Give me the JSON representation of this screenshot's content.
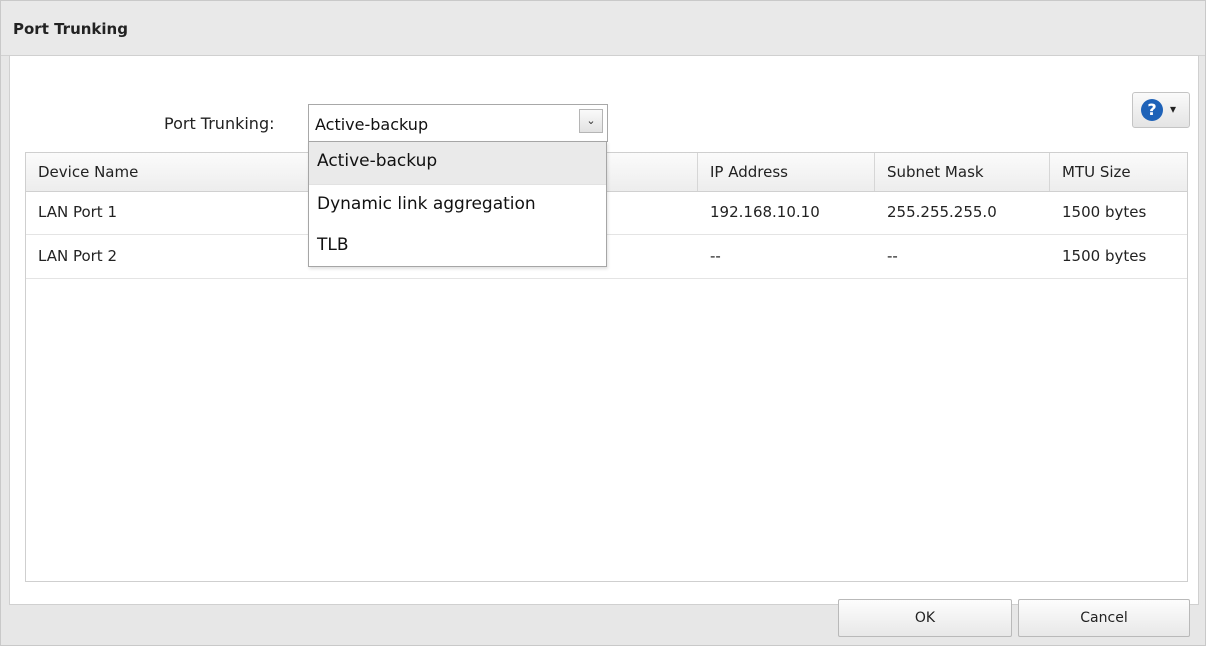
{
  "dialog": {
    "title": "Port Trunking"
  },
  "toolbar": {
    "help_symbol": "?",
    "help_caret": "▾",
    "help_icon_color": "#1e62b8"
  },
  "port_trunking": {
    "label": "Port Trunking:",
    "selected_value": "Active-backup",
    "options": [
      "Active-backup",
      "Dynamic link aggregation",
      "TLB"
    ]
  },
  "table": {
    "columns": [
      "Device Name",
      "IP Address",
      "Subnet Mask",
      "MTU Size"
    ],
    "rows": [
      {
        "device_name": "LAN Port 1",
        "ip_address": "192.168.10.10",
        "subnet_mask": "255.255.255.0",
        "mtu_size": "1500 bytes"
      },
      {
        "device_name": "LAN Port 2",
        "ip_address": "--",
        "subnet_mask": "--",
        "mtu_size": "1500 bytes"
      }
    ]
  },
  "footer": {
    "ok_label": "OK",
    "cancel_label": "Cancel"
  }
}
